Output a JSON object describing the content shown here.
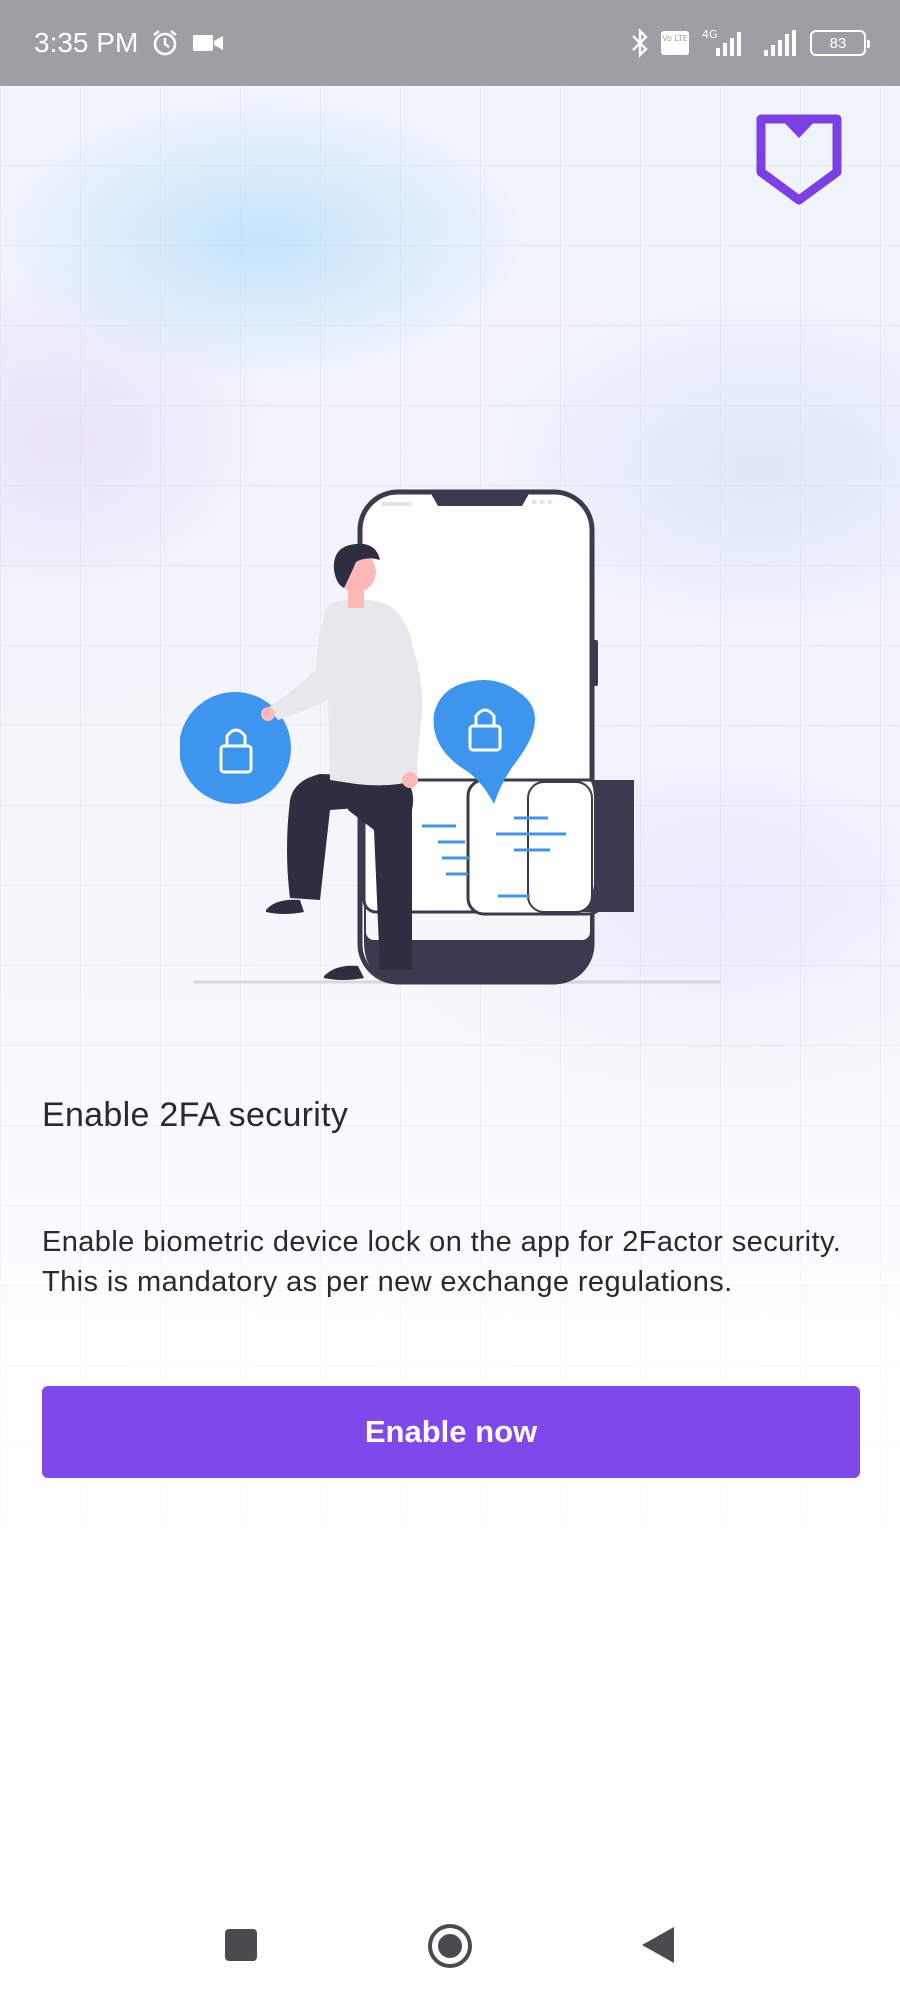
{
  "status_bar": {
    "time": "3:35 PM",
    "network_type": "4G",
    "volte": "Vo LTE",
    "battery_level": "83",
    "icons": [
      "alarm-icon",
      "video-camera-icon",
      "bluetooth-icon",
      "volte-icon",
      "signal-icon",
      "battery-icon"
    ]
  },
  "header": {
    "logo_icon": "shield-logo-icon",
    "logo_color": "#7b3fe4"
  },
  "illustration": {
    "name": "person-with-phone-lock-illustration",
    "accent_color": "#3d95ee"
  },
  "content": {
    "title": "Enable 2FA security",
    "description": "Enable biometric device lock on the app for 2Factor security. This is mandatory as per new exchange regulations."
  },
  "actions": {
    "enable_label": "Enable now",
    "button_color": "#7f48ea"
  },
  "nav_bar": {
    "icons": [
      "recent-apps-icon",
      "home-icon",
      "back-icon"
    ]
  }
}
